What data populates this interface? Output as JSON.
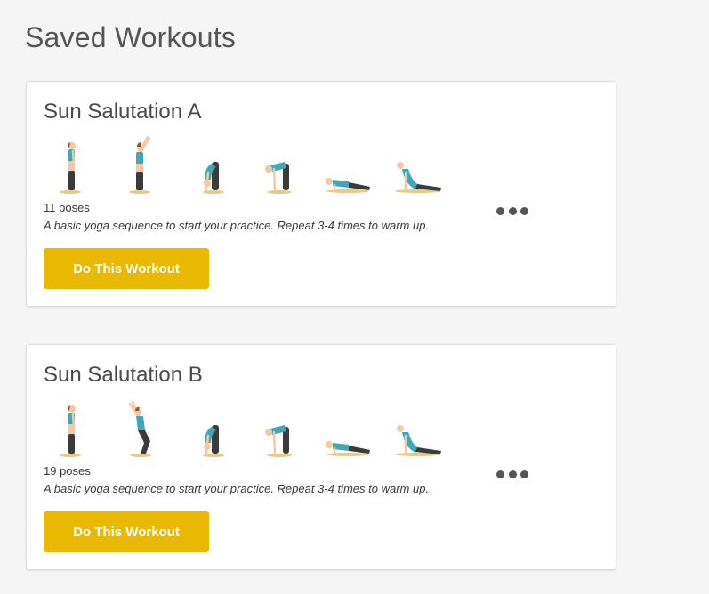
{
  "page": {
    "title": "Saved Workouts"
  },
  "colors": {
    "accent_button": "#e9b800",
    "skin": "#f2c9a0",
    "top": "#3fa7b8",
    "pants": "#3b3b3b",
    "hair": "#a0522d",
    "mat": "#e8c98a"
  },
  "workouts": [
    {
      "title": "Sun Salutation A",
      "pose_count": "11 poses",
      "description": "A basic yoga sequence to start your practice. Repeat 3-4 times to warm up.",
      "button_label": "Do This Workout",
      "poses": [
        "mountain-pose-icon",
        "upward-salute-icon",
        "standing-forward-bend-icon",
        "half-forward-bend-icon",
        "chaturanga-icon",
        "upward-dog-icon"
      ],
      "more_icon": "more-icon"
    },
    {
      "title": "Sun Salutation B",
      "pose_count": "19 poses",
      "description": "A basic yoga sequence to start your practice. Repeat 3-4 times to warm up.",
      "button_label": "Do This Workout",
      "poses": [
        "mountain-pose-icon",
        "chair-pose-icon",
        "standing-forward-bend-icon",
        "half-forward-bend-icon",
        "chaturanga-icon",
        "upward-dog-icon"
      ],
      "more_icon": "more-icon"
    }
  ]
}
